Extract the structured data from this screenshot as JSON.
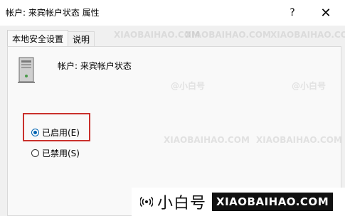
{
  "window": {
    "title": "帐户: 来宾帐户状态 属性",
    "help_glyph": "?",
    "close_glyph": "✕"
  },
  "tabs": [
    {
      "label": "本地安全设置",
      "active": true
    },
    {
      "label": "说明",
      "active": false
    }
  ],
  "panel": {
    "account_label": "帐户: 来宾帐户状态",
    "options": [
      {
        "label": "已启用(E)",
        "checked": true
      },
      {
        "label": "已禁用(S)",
        "checked": false
      }
    ]
  },
  "watermark": {
    "brand_cn": "小白号",
    "brand_en": "XIAOBAIHAO.COM",
    "faint_text": "XIAOBAIHAO.COM",
    "faint_cn": "@小白号"
  },
  "colors": {
    "highlight": "#c9302c",
    "radio_accent": "#0063b1"
  }
}
